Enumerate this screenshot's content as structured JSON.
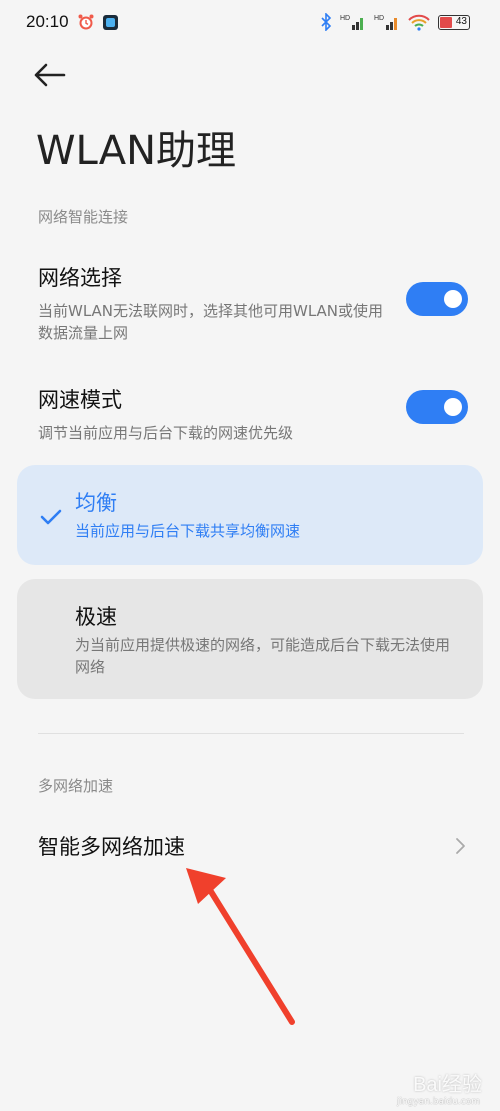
{
  "status_bar": {
    "time": "20:10",
    "battery": "43",
    "hd_label": "HD"
  },
  "header": {
    "title": "WLAN助理"
  },
  "sections": {
    "smart_connect_header": "网络智能连接",
    "multi_network_header": "多网络加速"
  },
  "settings": {
    "network_select": {
      "title": "网络选择",
      "desc": "当前WLAN无法联网时，选择其他可用WLAN或使用数据流量上网",
      "enabled": true
    },
    "speed_mode": {
      "title": "网速模式",
      "desc": "调节当前应用与后台下载的网速优先级",
      "enabled": true
    }
  },
  "speed_options": [
    {
      "title": "均衡",
      "desc": "当前应用与后台下载共享均衡网速",
      "selected": true
    },
    {
      "title": "极速",
      "desc": "为当前应用提供极速的网络，可能造成后台下载无法使用网络",
      "selected": false
    }
  ],
  "nav": {
    "smart_multi_network": "智能多网络加速"
  },
  "watermark": {
    "text": "Bai经验",
    "sub": "jingyan.baidu.com"
  },
  "colors": {
    "accent": "#2f7ef4",
    "selected_card": "#dde9f8",
    "unselected_card": "#e6e6e6",
    "annotation_arrow": "#f0402c"
  },
  "icons": {
    "back": "back-arrow-icon",
    "check": "check-icon",
    "chevron": "chevron-right-icon"
  }
}
